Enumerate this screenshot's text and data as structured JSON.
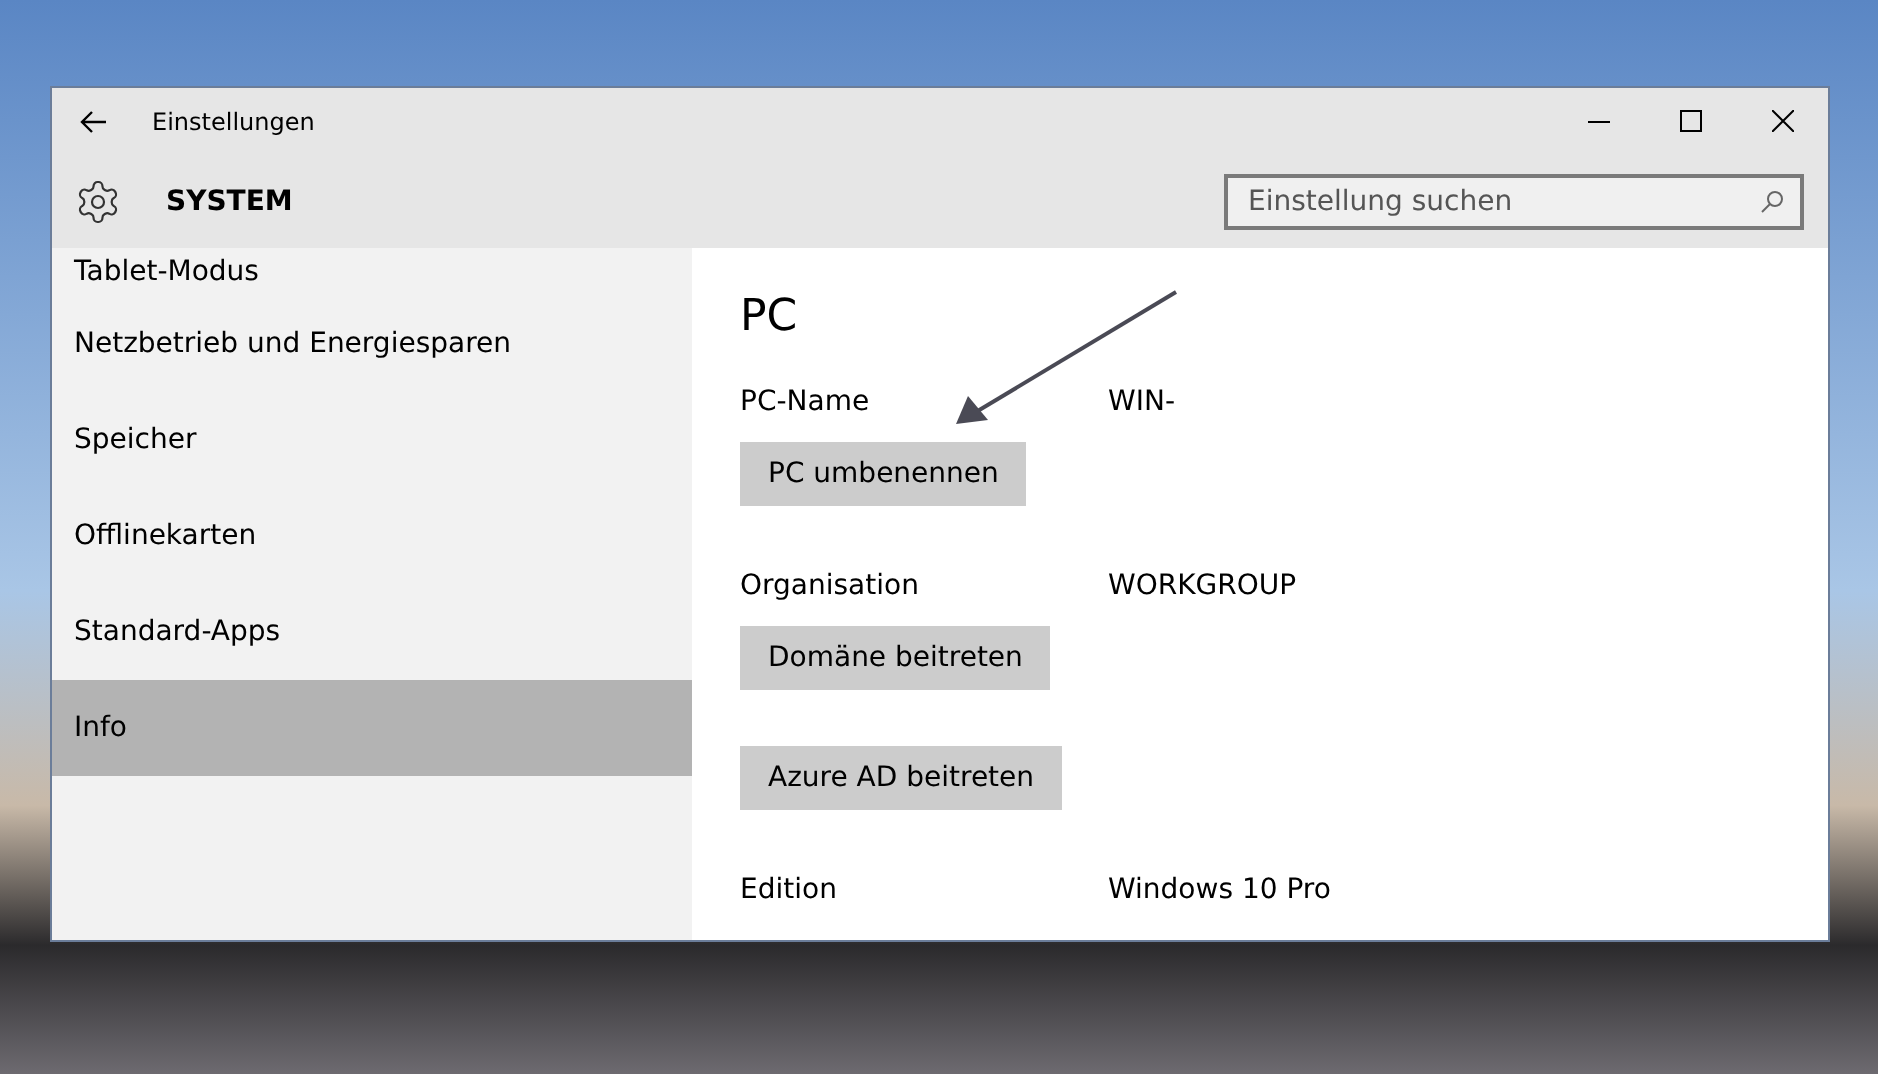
{
  "window": {
    "title": "Einstellungen"
  },
  "header": {
    "title": "SYSTEM",
    "search": {
      "placeholder": "Einstellung suchen"
    }
  },
  "sidebar": {
    "items": [
      {
        "label": "Tablet-Modus",
        "selected": false
      },
      {
        "label": "Netzbetrieb und Energiesparen",
        "selected": false
      },
      {
        "label": "Speicher",
        "selected": false
      },
      {
        "label": "Offlinekarten",
        "selected": false
      },
      {
        "label": "Standard-Apps",
        "selected": false
      },
      {
        "label": "Info",
        "selected": true
      }
    ]
  },
  "content": {
    "title": "PC",
    "items": [
      {
        "kind": "row",
        "label": "PC-Name",
        "value": "WIN-"
      },
      {
        "kind": "button",
        "label": "PC umbenennen"
      },
      {
        "kind": "row",
        "label": "Organisation",
        "value": "WORKGROUP"
      },
      {
        "kind": "button",
        "label": "Domäne beitreten"
      },
      {
        "kind": "button",
        "label": "Azure AD beitreten"
      },
      {
        "kind": "row",
        "label": "Edition",
        "value": "Windows 10 Pro"
      }
    ]
  }
}
